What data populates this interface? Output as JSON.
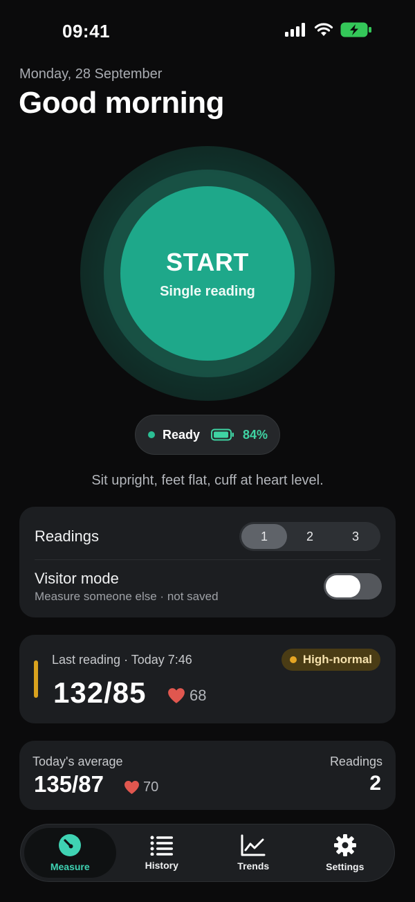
{
  "status_bar": {
    "time": "09:41"
  },
  "header": {
    "date": "Monday, 28 September",
    "greeting": "Good morning"
  },
  "start_button": {
    "title": "START",
    "subtitle": "Single reading"
  },
  "device": {
    "status": "Ready",
    "battery_percent": "84%"
  },
  "hint": "Sit upright, feet flat, cuff at heart level.",
  "settings": {
    "readings_label": "Readings",
    "readings_options": [
      "1",
      "2",
      "3"
    ],
    "readings_selected": "1",
    "visitor_label": "Visitor mode",
    "visitor_sublabel": "Measure someone else · not saved",
    "visitor_enabled": false
  },
  "last_reading": {
    "meta": "Last reading · Today 7:46",
    "value": "132/85",
    "pulse": "68",
    "badge": "High-normal"
  },
  "average": {
    "label": "Today's average",
    "value": "135/87",
    "pulse": "70",
    "count_label": "Readings",
    "count": "2"
  },
  "tabs": [
    {
      "label": "Measure",
      "icon": "gauge-icon",
      "active": true
    },
    {
      "label": "History",
      "icon": "list-icon",
      "active": false
    },
    {
      "label": "Trends",
      "icon": "chart-icon",
      "active": false
    },
    {
      "label": "Settings",
      "icon": "gear-icon",
      "active": false
    }
  ],
  "colors": {
    "accent": "#1ea88a",
    "warning": "#d9a21e",
    "heart": "#e0574f",
    "background": "#0b0b0c"
  }
}
